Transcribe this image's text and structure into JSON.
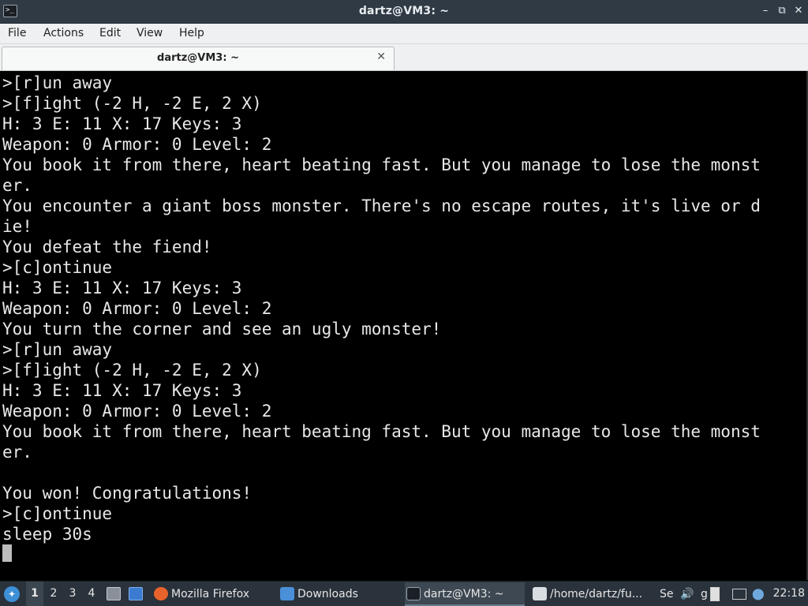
{
  "window": {
    "title": "dartz@VM3: ~",
    "controls": {
      "minimize": "–",
      "restore": "⧉",
      "close": "✕"
    }
  },
  "menu": [
    "File",
    "Actions",
    "Edit",
    "View",
    "Help"
  ],
  "tab": {
    "label": "dartz@VM3: ~",
    "close": "✕"
  },
  "terminal": {
    "lines": [
      ">[r]un away",
      ">[f]ight (-2 H, -2 E, 2 X)",
      "H: 3 E: 11 X: 17 Keys: 3",
      "Weapon: 0 Armor: 0 Level: 2",
      "You book it from there, heart beating fast. But you manage to lose the monst",
      "er.",
      "You encounter a giant boss monster. There's no escape routes, it's live or d",
      "ie!",
      "You defeat the fiend!",
      ">[c]ontinue",
      "H: 3 E: 11 X: 17 Keys: 3",
      "Weapon: 0 Armor: 0 Level: 2",
      "You turn the corner and see an ugly monster!",
      ">[r]un away",
      ">[f]ight (-2 H, -2 E, 2 X)",
      "H: 3 E: 11 X: 17 Keys: 3",
      "Weapon: 0 Armor: 0 Level: 2",
      "You book it from there, heart beating fast. But you manage to lose the monst",
      "er.",
      "",
      "You won! Congratulations!",
      ">[c]ontinue",
      "sleep 30s"
    ]
  },
  "taskbar": {
    "workspaces": [
      "1",
      "2",
      "3",
      "4"
    ],
    "active_workspace": "1",
    "tasks": [
      {
        "label": "Mozilla Firefox",
        "icon": "firefox-icon",
        "color": "#e8632b"
      },
      {
        "label": "Downloads",
        "icon": "folder-icon",
        "color": "#4a90d9"
      },
      {
        "label": "dartz@VM3: ~",
        "icon": "terminal-icon",
        "color": "#1b2026"
      },
      {
        "label": "/home/dartz/fu...",
        "icon": "text-editor-icon",
        "color": "#d8dde2"
      }
    ],
    "tray_text": [
      "Se",
      "g"
    ],
    "clock": "22:18"
  },
  "colors": {
    "titlebar": "#2f3a45",
    "menubar": "#eff0f1",
    "terminal_bg": "#000000",
    "terminal_fg": "#e8e8e8",
    "taskbar": "#2a323b"
  }
}
